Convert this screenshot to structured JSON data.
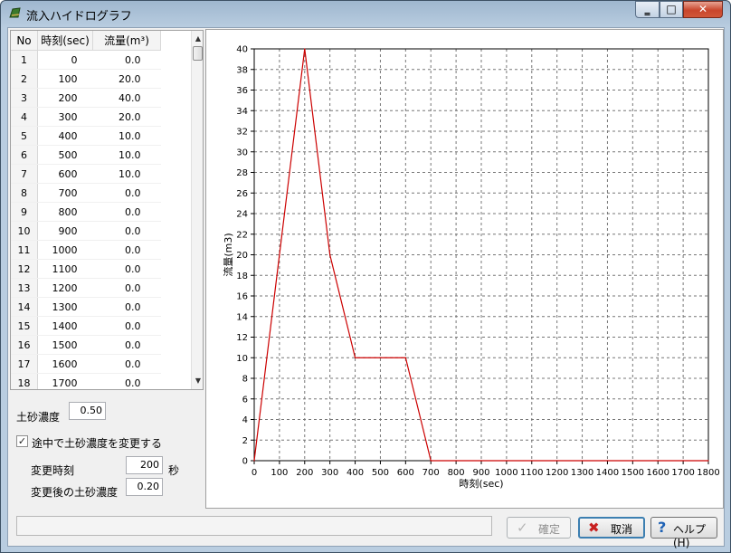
{
  "window": {
    "title": "流入ハイドログラフ",
    "controls": {
      "minimize": "‗",
      "maximize": "□",
      "close": "✕"
    }
  },
  "table": {
    "headers": [
      "No",
      "時刻(sec)",
      "流量(m³)"
    ],
    "rows": [
      [
        "1",
        "0",
        "0.0"
      ],
      [
        "2",
        "100",
        "20.0"
      ],
      [
        "3",
        "200",
        "40.0"
      ],
      [
        "4",
        "300",
        "20.0"
      ],
      [
        "5",
        "400",
        "10.0"
      ],
      [
        "6",
        "500",
        "10.0"
      ],
      [
        "7",
        "600",
        "10.0"
      ],
      [
        "8",
        "700",
        "0.0"
      ],
      [
        "9",
        "800",
        "0.0"
      ],
      [
        "10",
        "900",
        "0.0"
      ],
      [
        "11",
        "1000",
        "0.0"
      ],
      [
        "12",
        "1100",
        "0.0"
      ],
      [
        "13",
        "1200",
        "0.0"
      ],
      [
        "14",
        "1300",
        "0.0"
      ],
      [
        "15",
        "1400",
        "0.0"
      ],
      [
        "16",
        "1500",
        "0.0"
      ],
      [
        "17",
        "1600",
        "0.0"
      ],
      [
        "18",
        "1700",
        "0.0"
      ]
    ],
    "scroll_up": "▲",
    "scroll_down": "▼"
  },
  "form": {
    "sediment_label": "土砂濃度",
    "sediment_value": "0.50",
    "change_checkbox_label": "途中で土砂濃度を変更する",
    "change_checked": true,
    "change_time_label": "変更時刻",
    "change_time_value": "200",
    "change_time_unit": "秒",
    "after_label": "変更後の土砂濃度",
    "after_value": "0.20"
  },
  "buttons": {
    "ok": "確定",
    "cancel": "取消",
    "help": "ヘルプ(H)"
  },
  "colors": {
    "series": "#cc0000",
    "accent": "#3c7fb1"
  },
  "chart_data": {
    "type": "line",
    "title": "",
    "xlabel": "時刻(sec)",
    "ylabel": "流量(m3)",
    "xlim": [
      0,
      1800
    ],
    "ylim": [
      0,
      40
    ],
    "xticks": [
      0,
      100,
      200,
      300,
      400,
      500,
      600,
      700,
      800,
      900,
      1000,
      1100,
      1200,
      1300,
      1400,
      1500,
      1600,
      1700,
      1800
    ],
    "yticks": [
      0,
      2,
      4,
      6,
      8,
      10,
      12,
      14,
      16,
      18,
      20,
      22,
      24,
      26,
      28,
      30,
      32,
      34,
      36,
      38,
      40
    ],
    "grid": true,
    "series": [
      {
        "x": [
          0,
          100,
          200,
          300,
          400,
          500,
          600,
          700,
          800,
          900,
          1000,
          1100,
          1200,
          1300,
          1400,
          1500,
          1600,
          1700,
          1800
        ],
        "y": [
          0,
          20,
          40,
          20,
          10,
          10,
          10,
          0,
          0,
          0,
          0,
          0,
          0,
          0,
          0,
          0,
          0,
          0,
          0
        ]
      }
    ]
  }
}
